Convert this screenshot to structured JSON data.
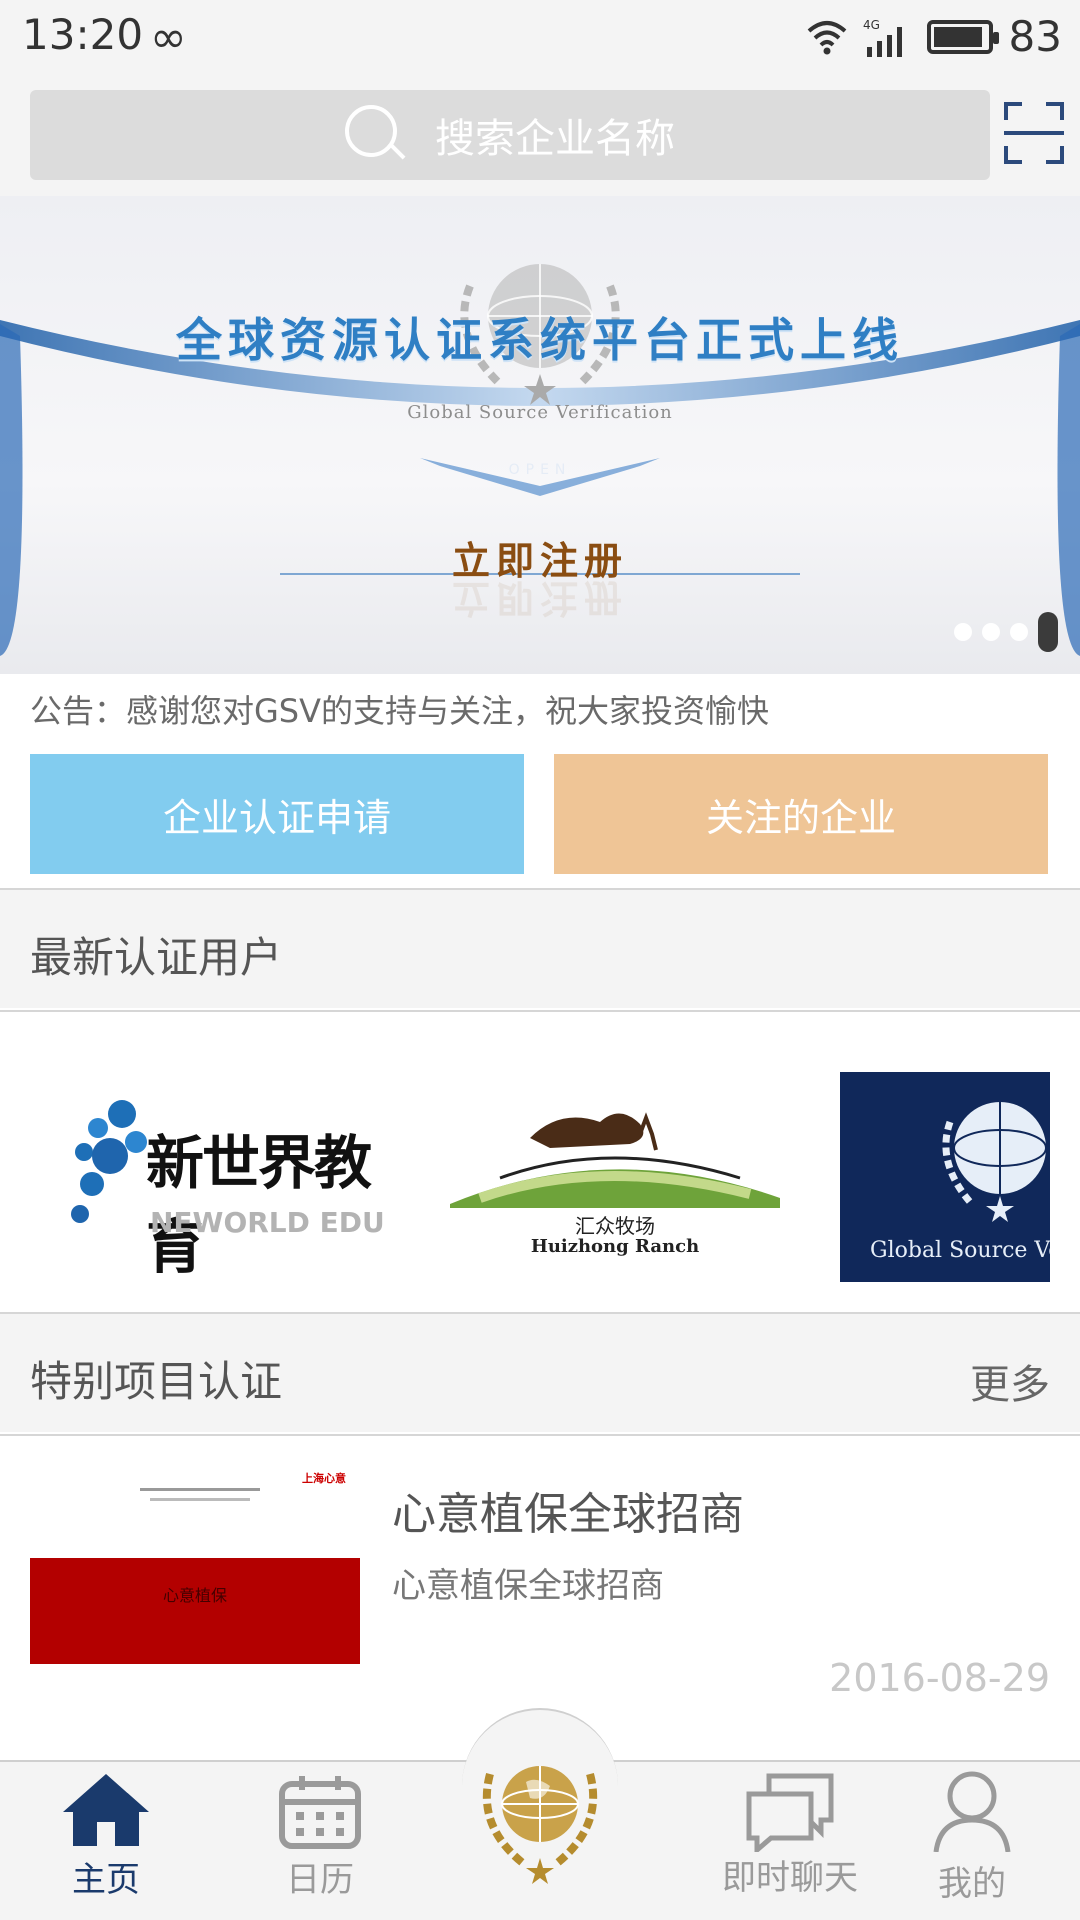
{
  "status_bar": {
    "time": "13:20",
    "infinity": "∞",
    "network": "4G",
    "battery_level": "83"
  },
  "search": {
    "placeholder": "搜索企业名称"
  },
  "banner": {
    "headline": "全球资源认证系统平台正式上线",
    "brand": "Global Source Verification",
    "open_tag": "OPEN",
    "cta": "立即注册",
    "page_count": 4,
    "active_page": 4
  },
  "notice": {
    "text": "公告：感谢您对GSV的支持与关注，祝大家投资愉快"
  },
  "actions": {
    "apply_label": "企业认证申请",
    "follow_label": "关注的企业"
  },
  "latest_users": {
    "title": "最新认证用户",
    "logos": [
      {
        "name": "新世界教育",
        "sub": "NEWORLD EDU"
      },
      {
        "name": "汇众牧场",
        "sub": "Huizhong Ranch"
      },
      {
        "name": "Global Source Ve"
      }
    ]
  },
  "special_projects": {
    "title": "特别项目认证",
    "more_label": "更多",
    "items": [
      {
        "title": "心意植保全球招商",
        "subtitle": "心意植保全球招商",
        "date": "2016-08-29",
        "thumb_title": "心意植保",
        "thumb_tag": "心意植保",
        "thumb_brand": "上海心意"
      }
    ]
  },
  "tabs": [
    {
      "label": "主页",
      "icon": "home-icon",
      "active": true
    },
    {
      "label": "日历",
      "icon": "calendar-icon",
      "active": false
    },
    {
      "label": "即时聊天",
      "icon": "chat-icon",
      "active": false
    },
    {
      "label": "我的",
      "icon": "user-icon",
      "active": false
    }
  ],
  "colors": {
    "accent_blue": "#82ccef",
    "accent_orange": "#efc596",
    "active_tab": "#1a3a6c",
    "headline_blue": "#2f7fc4"
  }
}
